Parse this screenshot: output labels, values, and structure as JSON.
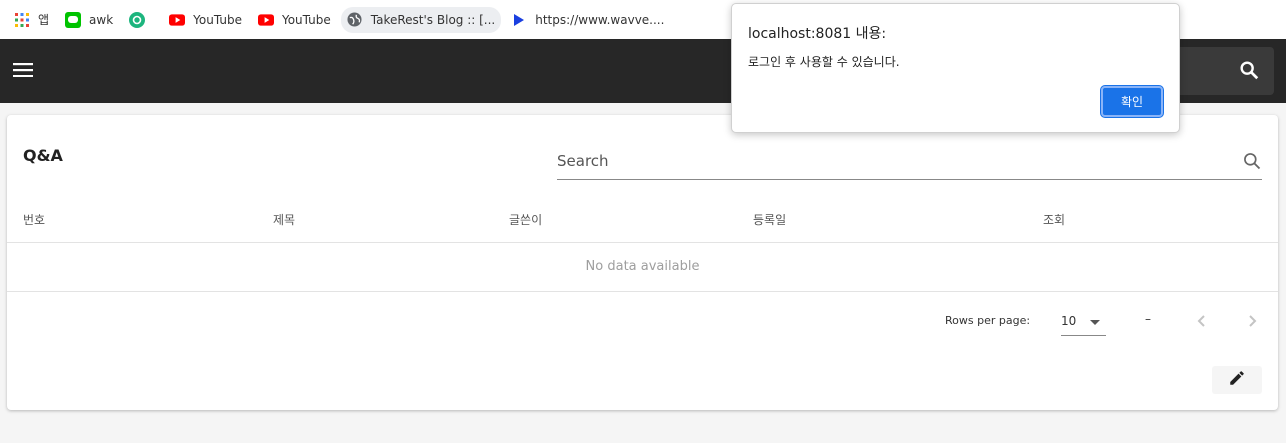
{
  "bookmarks": [
    {
      "label": "앱",
      "icon": "apps-grid-icon"
    },
    {
      "label": "awk",
      "icon": "line-icon"
    },
    {
      "label": "",
      "icon": "green-circle-icon"
    },
    {
      "label": "YouTube",
      "icon": "youtube-icon"
    },
    {
      "label": "YouTube",
      "icon": "youtube-icon"
    },
    {
      "label": "TakeRest's Blog :: [...",
      "icon": "globe-icon"
    },
    {
      "label": "https://www.wavve....",
      "icon": "wavve-icon"
    }
  ],
  "appbar": {
    "menu_icon": "hamburger-menu-icon",
    "search_icon": "search-icon"
  },
  "card": {
    "title": "Q&A",
    "search_placeholder": "Search",
    "columns": [
      "번호",
      "제목",
      "글쓴이",
      "등록일",
      "조회"
    ],
    "empty_text": "No data available",
    "rows_per_page_label": "Rows per page:",
    "rows_per_page_value": "10",
    "range_text": "–",
    "edit_icon": "pencil-icon"
  },
  "dialog": {
    "title": "localhost:8081 내용:",
    "message": "로그인 후 사용할 수 있습니다.",
    "ok_label": "확인"
  },
  "colors": {
    "appbar": "#272727",
    "accent": "#1a73e8"
  }
}
